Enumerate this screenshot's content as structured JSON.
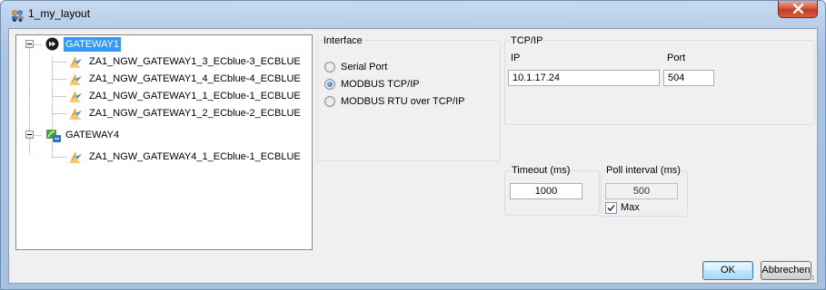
{
  "window": {
    "title": "1_my_layout",
    "title_icon": "layout-people-icon",
    "close_icon": "close-x-icon"
  },
  "tree": {
    "gateways": [
      {
        "label": "GATEWAY1",
        "icon": "fast-forward-circle-icon",
        "expanded": true,
        "selected": true,
        "children": [
          "ZA1_NGW_GATEWAY1_3_ECblue-3_ECBLUE",
          "ZA1_NGW_GATEWAY1_4_ECblue-4_ECBLUE",
          "ZA1_NGW_GATEWAY1_1_ECblue-1_ECBLUE",
          "ZA1_NGW_GATEWAY1_2_ECblue-2_ECBLUE"
        ]
      },
      {
        "label": "GATEWAY4",
        "icon": "gateway-network-icon",
        "expanded": true,
        "selected": false,
        "children": [
          "ZA1_NGW_GATEWAY4_1_ECblue-1_ECBLUE"
        ]
      }
    ],
    "child_icon": "fan-device-icon"
  },
  "interface": {
    "title": "Interface",
    "options": [
      {
        "label": "Serial Port",
        "checked": false
      },
      {
        "label": "MODBUS TCP/IP",
        "checked": true
      },
      {
        "label": "MODBUS RTU over TCP/IP",
        "checked": false
      }
    ]
  },
  "tcpip": {
    "title": "TCP/IP",
    "ip_label": "IP",
    "ip_value": "10.1.17.24",
    "port_label": "Port",
    "port_value": "504"
  },
  "timeout": {
    "title": "Timeout (ms)",
    "value": "1000"
  },
  "poll": {
    "title": "Poll interval (ms)",
    "value": "500",
    "max_label": "Max",
    "max_checked": true
  },
  "buttons": {
    "ok": "OK",
    "cancel": "Abbrechen"
  }
}
